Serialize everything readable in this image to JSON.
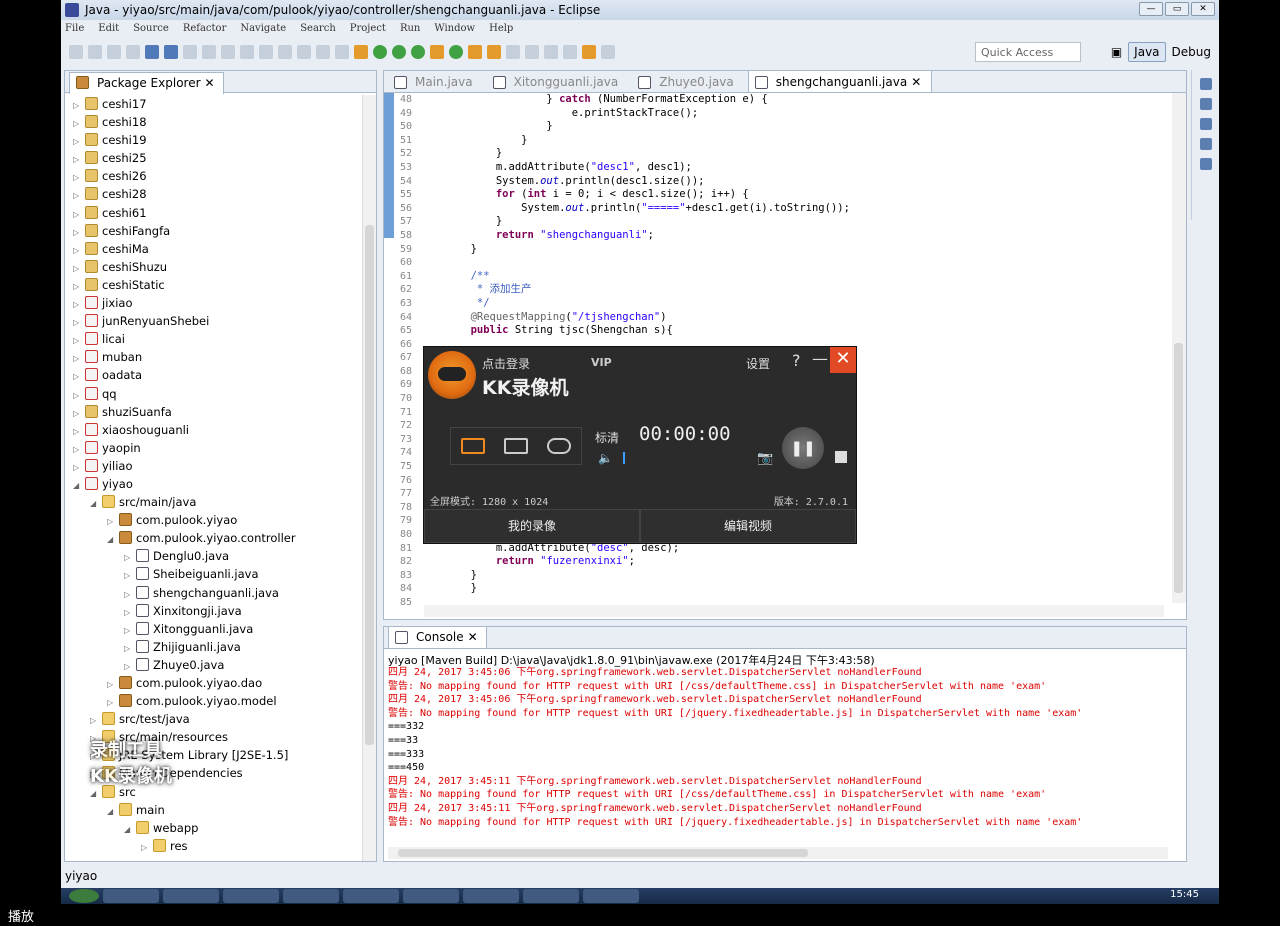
{
  "window": {
    "title": "Java - yiyao/src/main/java/com/pulook/yiyao/controller/shengchanguanli.java - Eclipse"
  },
  "menu": [
    "File",
    "Edit",
    "Source",
    "Refactor",
    "Navigate",
    "Search",
    "Project",
    "Run",
    "Window",
    "Help"
  ],
  "toolbar": {
    "quick_access": "Quick Access",
    "persp_java": "Java",
    "persp_debug": "Debug"
  },
  "package_explorer": {
    "title": "Package Explorer",
    "rows": [
      {
        "label": "ceshi17",
        "indent": 0,
        "icon": "proj",
        "tw": "▷"
      },
      {
        "label": "ceshi18",
        "indent": 0,
        "icon": "proj",
        "tw": "▷"
      },
      {
        "label": "ceshi19",
        "indent": 0,
        "icon": "proj",
        "tw": "▷"
      },
      {
        "label": "ceshi25",
        "indent": 0,
        "icon": "proj",
        "tw": "▷"
      },
      {
        "label": "ceshi26",
        "indent": 0,
        "icon": "proj",
        "tw": "▷"
      },
      {
        "label": "ceshi28",
        "indent": 0,
        "icon": "proj",
        "tw": "▷"
      },
      {
        "label": "ceshi61",
        "indent": 0,
        "icon": "proj",
        "tw": "▷"
      },
      {
        "label": "ceshiFangfa",
        "indent": 0,
        "icon": "proj",
        "tw": "▷"
      },
      {
        "label": "ceshiMa",
        "indent": 0,
        "icon": "proj",
        "tw": "▷"
      },
      {
        "label": "ceshiShuzu",
        "indent": 0,
        "icon": "proj",
        "tw": "▷"
      },
      {
        "label": "ceshiStatic",
        "indent": 0,
        "icon": "proj",
        "tw": "▷"
      },
      {
        "label": "jixiao",
        "indent": 0,
        "icon": "maven",
        "tw": "▷"
      },
      {
        "label": "junRenyuanShebei",
        "indent": 0,
        "icon": "maven",
        "tw": "▷"
      },
      {
        "label": "licai",
        "indent": 0,
        "icon": "maven",
        "tw": "▷"
      },
      {
        "label": "muban",
        "indent": 0,
        "icon": "maven",
        "tw": "▷"
      },
      {
        "label": "oadata",
        "indent": 0,
        "icon": "maven",
        "tw": "▷"
      },
      {
        "label": "qq",
        "indent": 0,
        "icon": "maven",
        "tw": "▷"
      },
      {
        "label": "shuziSuanfa",
        "indent": 0,
        "icon": "proj",
        "tw": "▷"
      },
      {
        "label": "xiaoshouguanli",
        "indent": 0,
        "icon": "maven",
        "tw": "▷"
      },
      {
        "label": "yaopin",
        "indent": 0,
        "icon": "maven",
        "tw": "▷"
      },
      {
        "label": "yiliao",
        "indent": 0,
        "icon": "maven",
        "tw": "▷"
      },
      {
        "label": "yiyao",
        "indent": 0,
        "icon": "maven",
        "tw": "◢"
      },
      {
        "label": "src/main/java",
        "indent": 1,
        "icon": "fold",
        "tw": "◢"
      },
      {
        "label": "com.pulook.yiyao",
        "indent": 2,
        "icon": "pkg",
        "tw": "▷"
      },
      {
        "label": "com.pulook.yiyao.controller",
        "indent": 2,
        "icon": "pkg",
        "tw": "◢"
      },
      {
        "label": "Denglu0.java",
        "indent": 3,
        "icon": "file",
        "tw": "▷"
      },
      {
        "label": "Sheibeiguanli.java",
        "indent": 3,
        "icon": "file",
        "tw": "▷"
      },
      {
        "label": "shengchanguanli.java",
        "indent": 3,
        "icon": "file",
        "tw": "▷"
      },
      {
        "label": "Xinxitongji.java",
        "indent": 3,
        "icon": "file",
        "tw": "▷"
      },
      {
        "label": "Xitongguanli.java",
        "indent": 3,
        "icon": "file",
        "tw": "▷"
      },
      {
        "label": "Zhijiguanli.java",
        "indent": 3,
        "icon": "file",
        "tw": "▷"
      },
      {
        "label": "Zhuye0.java",
        "indent": 3,
        "icon": "file",
        "tw": "▷"
      },
      {
        "label": "com.pulook.yiyao.dao",
        "indent": 2,
        "icon": "pkg",
        "tw": "▷"
      },
      {
        "label": "com.pulook.yiyao.model",
        "indent": 2,
        "icon": "pkg",
        "tw": "▷"
      },
      {
        "label": "src/test/java",
        "indent": 1,
        "icon": "fold",
        "tw": "▷"
      },
      {
        "label": "src/main/resources",
        "indent": 1,
        "icon": "fold",
        "tw": "▷"
      },
      {
        "label": "JRE System Library [J2SE-1.5]",
        "indent": 1,
        "icon": "fold",
        "tw": "▷"
      },
      {
        "label": "Maven Dependencies",
        "indent": 1,
        "icon": "fold",
        "tw": "▷"
      },
      {
        "label": "src",
        "indent": 1,
        "icon": "fold",
        "tw": "◢"
      },
      {
        "label": "main",
        "indent": 2,
        "icon": "fold",
        "tw": "◢"
      },
      {
        "label": "webapp",
        "indent": 3,
        "icon": "fold",
        "tw": "◢"
      },
      {
        "label": "res",
        "indent": 4,
        "icon": "fold",
        "tw": "▷"
      }
    ]
  },
  "editor": {
    "tabs": [
      "Main.java",
      "Xitongguanli.java",
      "Zhuye0.java",
      "shengchanguanli.java"
    ],
    "active_tab": 3,
    "lines": [
      {
        "n": "48",
        "html": "            } <k>catch</k> (NumberFormatException e) {"
      },
      {
        "n": "49",
        "html": "                e.printStackTrace();"
      },
      {
        "n": "50",
        "html": "            }"
      },
      {
        "n": "51",
        "html": "        }"
      },
      {
        "n": "52",
        "html": "    }"
      },
      {
        "n": "53",
        "html": "    m.addAttribute(<s>\"desc1\"</s>, desc1);"
      },
      {
        "n": "54",
        "html": "    System.<f>out</f>.println(desc1.size());"
      },
      {
        "n": "55",
        "html": "    <k>for</k> (<k>int</k> i = 0; i < desc1.size(); i++) {"
      },
      {
        "n": "56",
        "html": "        System.<f>out</f>.println(<s>\"=====\"</s>+desc1.get(i).toString());"
      },
      {
        "n": "57",
        "html": "    }"
      },
      {
        "n": "58",
        "html": "    <k>return</k> <s>\"shengchanguanli\"</s>;"
      },
      {
        "n": "59",
        "html": "}"
      },
      {
        "n": "60",
        "html": ""
      },
      {
        "n": "61",
        "html": "<c>/**</c>"
      },
      {
        "n": "62",
        "html": "<c> * 添加生产</c>"
      },
      {
        "n": "63",
        "html": "<c> */</c>"
      },
      {
        "n": "64",
        "html": "<a>@RequestMapping</a>(<s>\"/tjshengchan\"</s>)"
      },
      {
        "n": "65",
        "html": "<k>public</k> String tjsc(Shengchan s){"
      },
      {
        "n": "66",
        "html": ""
      },
      {
        "n": "67",
        "html": ""
      },
      {
        "n": "68",
        "html": ""
      },
      {
        "n": "69",
        "html": ""
      },
      {
        "n": "70",
        "html": ""
      },
      {
        "n": "71",
        "html": ""
      },
      {
        "n": "72",
        "html": ""
      },
      {
        "n": "73",
        "html": ""
      },
      {
        "n": "74",
        "html": ""
      },
      {
        "n": "75",
        "html": ""
      },
      {
        "n": "76",
        "html": ""
      },
      {
        "n": "77",
        "html": ""
      },
      {
        "n": "78",
        "html": ""
      },
      {
        "n": "79",
        "html": ""
      },
      {
        "n": "80",
        "html": ""
      },
      {
        "n": "81",
        "html": "    m.addAttribute(<s>\"desc\"</s>, desc);"
      },
      {
        "n": "82",
        "html": "    <k>return</k> <s>\"fuzerenxinxi\"</s>;"
      },
      {
        "n": "83",
        "html": "}"
      },
      {
        "n": "84",
        "html": "}"
      },
      {
        "n": "85",
        "html": ""
      }
    ]
  },
  "console": {
    "title": "Console",
    "header": "yiyao [Maven Build] D:\\java\\Java\\jdk1.8.0_91\\bin\\javaw.exe (2017年4月24日 下午3:43:58)",
    "lines": [
      {
        "t": "四月 24, 2017 3:45:06 下午org.springframework.web.servlet.DispatcherServlet noHandlerFound",
        "red": true
      },
      {
        "t": "警告: No mapping found for HTTP request with URI [/css/defaultTheme.css] in DispatcherServlet with name 'exam'",
        "red": true
      },
      {
        "t": "四月 24, 2017 3:45:06 下午org.springframework.web.servlet.DispatcherServlet noHandlerFound",
        "red": true
      },
      {
        "t": "警告: No mapping found for HTTP request with URI [/jquery.fixedheadertable.js] in DispatcherServlet with name 'exam'",
        "red": true
      },
      {
        "t": "===332",
        "red": false
      },
      {
        "t": "===33",
        "red": false
      },
      {
        "t": "===333",
        "red": false
      },
      {
        "t": "===450",
        "red": false
      },
      {
        "t": "四月 24, 2017 3:45:11 下午org.springframework.web.servlet.DispatcherServlet noHandlerFound",
        "red": true
      },
      {
        "t": "警告: No mapping found for HTTP request with URI [/css/defaultTheme.css] in DispatcherServlet with name 'exam'",
        "red": true
      },
      {
        "t": "四月 24, 2017 3:45:11 下午org.springframework.web.servlet.DispatcherServlet noHandlerFound",
        "red": true
      },
      {
        "t": "警告: No mapping found for HTTP request with URI [/jquery.fixedheadertable.js] in DispatcherServlet with name 'exam'",
        "red": true
      }
    ]
  },
  "status": {
    "text": "yiyao"
  },
  "taskbar": {
    "clock": "15:45"
  },
  "caption": "播放",
  "watermark": {
    "line1": "录制工具",
    "line2": "KK录像机"
  },
  "kk": {
    "login": "点击登录",
    "vip": "VIP",
    "title": "KK录像机",
    "settings": "设置",
    "help": "?",
    "minimize": "—",
    "close": "✕",
    "quality": "标清",
    "timer": "00:00:00",
    "mode_text": "全屏模式: 1280 x 1024",
    "version": "版本: 2.7.0.1",
    "btn_recordings": "我的录像",
    "btn_edit": "编辑视频"
  }
}
